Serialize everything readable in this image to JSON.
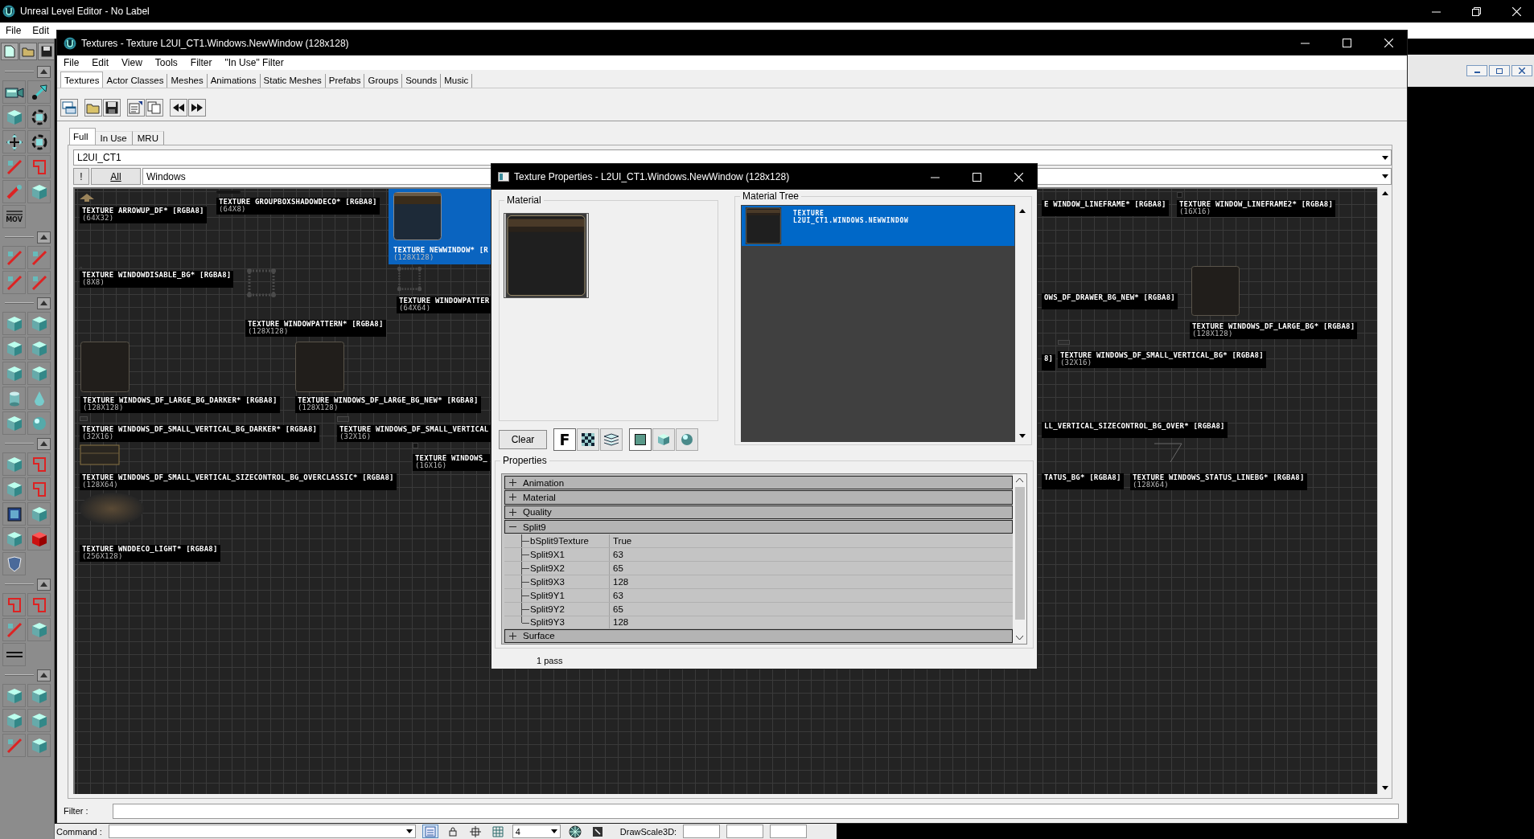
{
  "app": {
    "title": "Unreal Level Editor - No Label",
    "menu": [
      "File",
      "Edit"
    ],
    "tool_label": "MOV"
  },
  "textures_window": {
    "title": "Textures - Texture L2UI_CT1.Windows.NewWindow (128x128)",
    "menu": [
      "File",
      "Edit",
      "View",
      "Tools",
      "Filter",
      "\"In Use\" Filter"
    ],
    "tabs": [
      {
        "label": "Textures",
        "selected": true
      },
      {
        "label": "Actor Classes",
        "selected": false
      },
      {
        "label": "Meshes",
        "selected": false
      },
      {
        "label": "Animations",
        "selected": false
      },
      {
        "label": "Static Meshes",
        "selected": false
      },
      {
        "label": "Prefabs",
        "selected": false
      },
      {
        "label": "Groups",
        "selected": false
      },
      {
        "label": "Sounds",
        "selected": false
      },
      {
        "label": "Music",
        "selected": false
      }
    ],
    "view_tabs": [
      {
        "label": "Full",
        "selected": true
      },
      {
        "label": "In Use",
        "selected": false
      },
      {
        "label": "MRU",
        "selected": false
      }
    ],
    "package": "L2UI_CT1",
    "bang_button": "!",
    "all_button": "All",
    "group": "Windows",
    "textures": [
      {
        "name": "TEXTURE ARROWUP_DF* [RGBA8]",
        "size": "(64X32)",
        "selected": false,
        "kind": "arrow"
      },
      {
        "name": "TEXTURE GROUPBOXSHADOWDECO* [RGBA8]",
        "size": "(64X8)",
        "selected": false,
        "kind": "shadow"
      },
      {
        "name": "TEXTURE NEWWINDOW* [R",
        "size": "(128X128)",
        "selected": true,
        "kind": "window"
      },
      {
        "name": "TEXTURE WINDOWDISABLE_BG* [RGBA8]",
        "size": "(8X8)",
        "selected": false,
        "kind": "dot"
      },
      {
        "name": "TEXTURE WINDOWPATTER",
        "size": "(64X64)",
        "selected": false,
        "kind": "pattern"
      },
      {
        "name": "TEXTURE WINDOWPATTERN* [RGBA8]",
        "size": "(128X128)",
        "selected": false,
        "kind": "pattern"
      },
      {
        "name": "TEXTURE WINDOWS_DF_LARGE_BG_DARKER* [RGBA8]",
        "size": "(128X128)",
        "selected": false,
        "kind": "panel"
      },
      {
        "name": "TEXTURE WINDOWS_DF_LARGE_BG_NEW* [RGBA8]",
        "size": "(128X128)",
        "selected": false,
        "kind": "panel"
      },
      {
        "name": "TEXTURE WINDOWS_DF_SMALL_VERTICAL_BG_DARKER* [RGBA8]",
        "size": "(32X16)",
        "selected": false,
        "kind": "strip"
      },
      {
        "name": "TEXTURE WINDOWS_DF_SMALL_VERTICAL",
        "size": "(32X16)",
        "selected": false,
        "kind": "strip"
      },
      {
        "name": "TEXTURE WINDOWS_DF_SMALL_VERTICAL_SIZECONTROL_BG_OVERCLASSIC* [RGBA8]",
        "size": "(128X64)",
        "selected": false,
        "kind": "goldframe"
      },
      {
        "name": "TEXTURE WINDOWS_",
        "size": "(16X16)",
        "selected": false,
        "kind": "dot"
      },
      {
        "name": "TEXTURE WNDDECO_LIGHT* [RGBA8]",
        "size": "(256X128)",
        "selected": false,
        "kind": "glow"
      },
      {
        "name": "E WINDOW_LINEFRAME* [RGBA8]",
        "selected": false,
        "kind": "none"
      },
      {
        "name": "TEXTURE WINDOW_LINEFRAME2* [RGBA8]",
        "size": "(16X16)",
        "selected": false,
        "kind": "dot"
      },
      {
        "name": "OWS_DF_DRAWER_BG_NEW* [RGBA8]",
        "selected": false,
        "kind": "none"
      },
      {
        "name": "TEXTURE WINDOWS_DF_LARGE_BG* [RGBA8]",
        "size": "(128X128)",
        "selected": false,
        "kind": "panel"
      },
      {
        "name": "8]",
        "selected": false,
        "kind": "none"
      },
      {
        "name": "TEXTURE WINDOWS_DF_SMALL_VERTICAL_BG* [RGBA8]",
        "size": "(32X16)",
        "selected": false,
        "kind": "strip"
      },
      {
        "name": "LL_VERTICAL_SIZECONTROL_BG_OVER* [RGBA8]",
        "selected": false,
        "kind": "none"
      },
      {
        "name": "TATUS_BG* [RGBA8]",
        "selected": false,
        "kind": "none"
      },
      {
        "name": "TEXTURE WINDOWS_STATUS_LINEBG* [RGBA8]",
        "size": "(128X64)",
        "selected": false,
        "kind": "line"
      }
    ],
    "filter_label": "Filter :"
  },
  "properties_dialog": {
    "title": "Texture Properties - L2UI_CT1.Windows.NewWindow (128x128)",
    "material_label": "Material",
    "tree_label": "Material Tree",
    "tree_items": [
      {
        "type": "TEXTURE",
        "path": "L2UI_CT1.WINDOWS.NEWWINDOW",
        "selected": true
      }
    ],
    "clear_button": "Clear",
    "mode_buttons": [
      {
        "kind": "letter",
        "label": "F",
        "selected": true
      },
      {
        "kind": "checker",
        "selected": false
      },
      {
        "kind": "layers",
        "selected": false
      }
    ],
    "shape_buttons": [
      {
        "kind": "plane",
        "selected": true
      },
      {
        "kind": "cube",
        "selected": false
      },
      {
        "kind": "sphere",
        "selected": false
      }
    ],
    "properties_label": "Properties",
    "categories": [
      {
        "name": "Animation",
        "expanded": false
      },
      {
        "name": "Material",
        "expanded": false
      },
      {
        "name": "Quality",
        "expanded": false
      },
      {
        "name": "Split9",
        "expanded": true,
        "children": [
          {
            "name": "bSplit9Texture",
            "value": "True"
          },
          {
            "name": "Split9X1",
            "value": "63"
          },
          {
            "name": "Split9X2",
            "value": "65"
          },
          {
            "name": "Split9X3",
            "value": "128"
          },
          {
            "name": "Split9Y1",
            "value": "63"
          },
          {
            "name": "Split9Y2",
            "value": "65"
          },
          {
            "name": "Split9Y3",
            "value": "128"
          }
        ]
      },
      {
        "name": "Surface",
        "expanded": false
      }
    ],
    "passes": "1 pass"
  },
  "status_bar": {
    "command_label": "Command :",
    "grid_size": "4",
    "drawscale_label": "DrawScale3D:"
  }
}
